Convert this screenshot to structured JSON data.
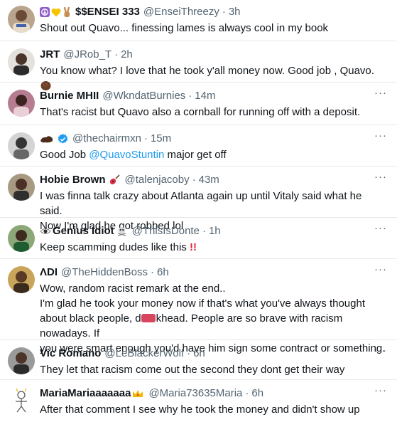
{
  "tweets": [
    {
      "name": "$$ENSEI 333",
      "handle": "@EnseiThreezy",
      "time": "3h",
      "text": "Shout out Quavo... finessing lames is always cool in my book"
    },
    {
      "name": "JRT",
      "handle": "@JRob_T",
      "time": "2h",
      "text": "You know what? I love that he took y'all money now. Good job , Quavo."
    },
    {
      "name": "Burnie MHII",
      "handle": "@WkndatBurnies",
      "time": "14m",
      "text": "That's racist but Quavo also a cornball for running off with a deposit."
    },
    {
      "name": "",
      "handle": "@thechairmxn",
      "time": "15m",
      "text_pre": "Good Job ",
      "mention": "@QuavoStuntin",
      "text_post": " major get off"
    },
    {
      "name": "Hobie Brown",
      "handle": "@talenjacoby",
      "time": "43m",
      "lines": [
        "I was finna talk crazy about Atlanta again up until Vitaly said what he said.",
        "Now I'm glad he got robbed lol"
      ]
    },
    {
      "name": "Genius Idiot",
      "handle": "@ThisIsDonte",
      "time": "1h",
      "text": "Keep scamming dudes like this",
      "bang": "!!"
    },
    {
      "name": "ΛDI",
      "handle": "@TheHiddenBoss",
      "time": "6h",
      "lines": [
        "Wow, random racist remark at the end..",
        "I'm glad he took your money now if that's what you've always thought",
        "about black people, d",
        "khead. People are so brave with racism nowadays. If",
        "you were smart enough you'd have him sign some contract or something."
      ]
    },
    {
      "name": "Vic Romano",
      "handle": "@LeBlackerWolf",
      "time": "6h",
      "text": "They let that racism come out the second they dont get their way"
    },
    {
      "name": "MariaMariaaaaaaa",
      "handle": "@Maria73635Maria",
      "time": "6h",
      "text": "After that comment I see why he took the money and didn't show up"
    }
  ],
  "ui": {
    "dot": "·",
    "more": "···"
  },
  "icons": {
    "more": "more-options-icon",
    "verified": "verified-badge-icon",
    "colors": {
      "verified": "#1d9bf0",
      "handle": "#536471",
      "mention": "#1d9bf0",
      "bang": "#e0243b",
      "redact": "#d8455f"
    }
  }
}
